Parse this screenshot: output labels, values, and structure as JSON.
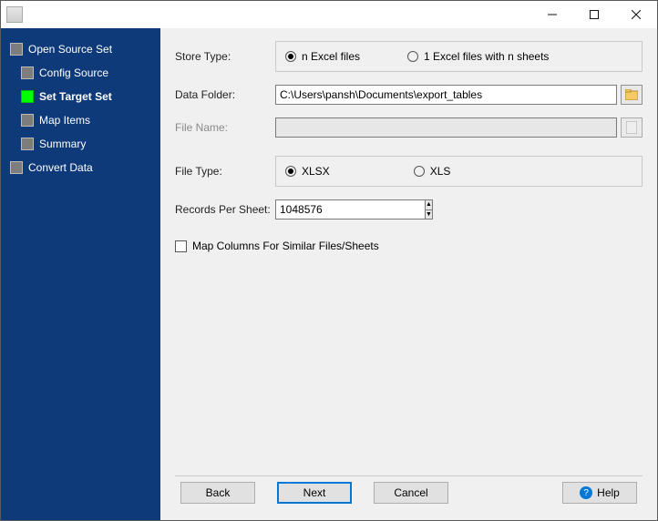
{
  "window": {
    "title": ""
  },
  "sidebar": {
    "items": [
      {
        "label": "Open Source Set"
      },
      {
        "label": "Config Source"
      },
      {
        "label": "Set Target Set"
      },
      {
        "label": "Map Items"
      },
      {
        "label": "Summary"
      },
      {
        "label": "Convert Data"
      }
    ]
  },
  "form": {
    "store_type_label": "Store Type:",
    "store_type_opts": {
      "a": "n Excel files",
      "b": "1 Excel files with n sheets"
    },
    "data_folder_label": "Data Folder:",
    "data_folder_value": "C:\\Users\\pansh\\Documents\\export_tables",
    "file_name_label": "File Name:",
    "file_name_value": "",
    "file_type_label": "File Type:",
    "file_type_opts": {
      "a": "XLSX",
      "b": "XLS"
    },
    "records_label": "Records Per Sheet:",
    "records_value": "1048576",
    "map_columns_label": "Map Columns For Similar Files/Sheets"
  },
  "footer": {
    "back": "Back",
    "next": "Next",
    "cancel": "Cancel",
    "help": "Help"
  }
}
